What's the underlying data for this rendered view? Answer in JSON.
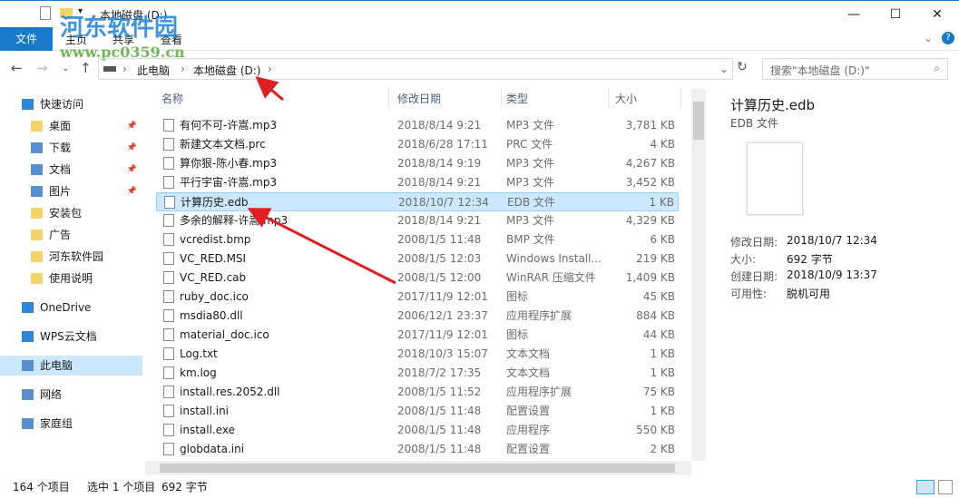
{
  "window": {
    "title": "本地磁盘 (D:)",
    "minimize": "—",
    "maximize": "☐",
    "close": "✕"
  },
  "ribbon": {
    "file": "文件",
    "tabs": [
      "主页",
      "共享",
      "查看"
    ],
    "help": "?"
  },
  "address": {
    "crumbs": [
      "此电脑",
      "本地磁盘 (D:)"
    ],
    "search_placeholder": "搜索\"本地磁盘 (D:)\""
  },
  "sidebar": {
    "items": [
      {
        "label": "快速访问",
        "icon": "star-icon"
      },
      {
        "label": "桌面",
        "icon": "folder-icon",
        "pinned": true
      },
      {
        "label": "下载",
        "icon": "download-icon",
        "pinned": true
      },
      {
        "label": "文档",
        "icon": "document-icon",
        "pinned": true
      },
      {
        "label": "图片",
        "icon": "picture-icon",
        "pinned": true
      },
      {
        "label": "安装包",
        "icon": "folder-icon"
      },
      {
        "label": "广告",
        "icon": "folder-icon"
      },
      {
        "label": "河东软件园",
        "icon": "folder-icon"
      },
      {
        "label": "使用说明",
        "icon": "folder-icon"
      },
      {
        "label": "OneDrive",
        "icon": "cloud-icon"
      },
      {
        "label": "WPS云文档",
        "icon": "cloud-icon"
      },
      {
        "label": "此电脑",
        "icon": "computer-icon",
        "selected": true
      },
      {
        "label": "网络",
        "icon": "network-icon"
      },
      {
        "label": "家庭组",
        "icon": "homegroup-icon"
      }
    ]
  },
  "columns": [
    "名称",
    "修改日期",
    "类型",
    "大小"
  ],
  "files": [
    [
      "有何不可-许嵩.mp3",
      "2018/8/14 9:21",
      "MP3 文件",
      "3,781 KB"
    ],
    [
      "新建文本文档.prc",
      "2018/6/28 17:11",
      "PRC 文件",
      "4 KB"
    ],
    [
      "算你狠-陈小春.mp3",
      "2018/8/14 9:19",
      "MP3 文件",
      "4,267 KB"
    ],
    [
      "平行宇宙-许嵩.mp3",
      "2018/8/14 9:21",
      "MP3 文件",
      "3,452 KB"
    ],
    [
      "计算历史.edb",
      "2018/10/7 12:34",
      "EDB 文件",
      "1 KB"
    ],
    [
      "多余的解释-许嵩.mp3",
      "2018/8/14 9:21",
      "MP3 文件",
      "4,329 KB"
    ],
    [
      "vcredist.bmp",
      "2008/1/5 11:48",
      "BMP 文件",
      "6 KB"
    ],
    [
      "VC_RED.MSI",
      "2008/1/5 12:03",
      "Windows Install...",
      "219 KB"
    ],
    [
      "VC_RED.cab",
      "2008/1/5 12:00",
      "WinRAR 压缩文件",
      "1,409 KB"
    ],
    [
      "ruby_doc.ico",
      "2017/11/9 12:01",
      "图标",
      "45 KB"
    ],
    [
      "msdia80.dll",
      "2006/12/1 23:37",
      "应用程序扩展",
      "884 KB"
    ],
    [
      "material_doc.ico",
      "2017/11/9 12:01",
      "图标",
      "44 KB"
    ],
    [
      "Log.txt",
      "2018/10/3 15:07",
      "文本文档",
      "1 KB"
    ],
    [
      "km.log",
      "2018/7/2 17:35",
      "文本文档",
      "1 KB"
    ],
    [
      "install.res.2052.dll",
      "2008/1/5 11:52",
      "应用程序扩展",
      "75 KB"
    ],
    [
      "install.ini",
      "2008/1/5 11:48",
      "配置设置",
      "1 KB"
    ],
    [
      "install.exe",
      "2008/1/5 11:48",
      "应用程序",
      "550 KB"
    ],
    [
      "globdata.ini",
      "2008/1/5 11:48",
      "配置设置",
      "2 KB"
    ]
  ],
  "selected_index": 4,
  "details": {
    "name": "计算历史.edb",
    "type": "EDB 文件",
    "props": [
      [
        "修改日期:",
        "2018/10/7 12:34"
      ],
      [
        "大小:",
        "692 字节"
      ],
      [
        "创建日期:",
        "2018/10/9 13:37"
      ],
      [
        "可用性:",
        "脱机可用"
      ]
    ]
  },
  "status": {
    "count": "164 个项目",
    "selection": "选中 1 个项目",
    "size": "692 字节"
  },
  "watermark": {
    "name": "河东软件园",
    "url": "www.pc0359.cn"
  }
}
